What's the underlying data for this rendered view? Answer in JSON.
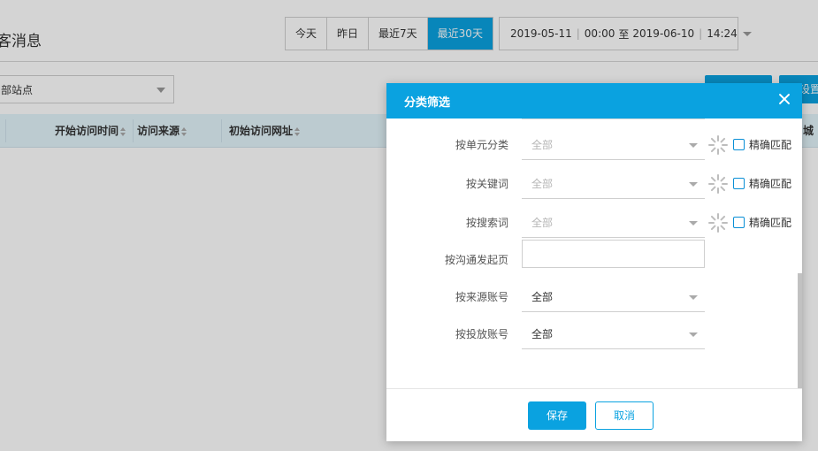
{
  "page": {
    "title": "客消息",
    "date_quick": [
      "今天",
      "昨日",
      "最近7天",
      "最近30天"
    ],
    "date_quick_active": "最近30天",
    "date_range": {
      "start_date": "2019-05-11",
      "start_time": "00:00",
      "to": "至",
      "end_date": "2019-06-10",
      "end_time": "14:24"
    },
    "site_select": "部站点",
    "top_button_2": "设置",
    "columns": [
      "开始访问时间",
      "访问来源",
      "初始访问网址",
      "城"
    ]
  },
  "modal": {
    "title": "分类筛选",
    "fields": [
      {
        "label": "按单元分类",
        "value": "全部",
        "muted": true,
        "exact_match": "精确匹配"
      },
      {
        "label": "按关键词",
        "value": "全部",
        "muted": true,
        "exact_match": "精确匹配"
      },
      {
        "label": "按搜索词",
        "value": "全部",
        "muted": true,
        "exact_match": "精确匹配"
      },
      {
        "label": "按沟通发起页",
        "value": ""
      },
      {
        "label": "按来源账号",
        "value": "全部",
        "muted": false
      },
      {
        "label": "按投放账号",
        "value": "全部",
        "muted": false
      }
    ],
    "save_label": "保存",
    "cancel_label": "取消"
  },
  "colors": {
    "accent": "#0aa2e0",
    "table_header_bg": "#e3f4fb"
  },
  "icons": {
    "close": "close-icon",
    "loading": "loading-spinner-icon",
    "dropdown": "chevron-down-icon"
  }
}
